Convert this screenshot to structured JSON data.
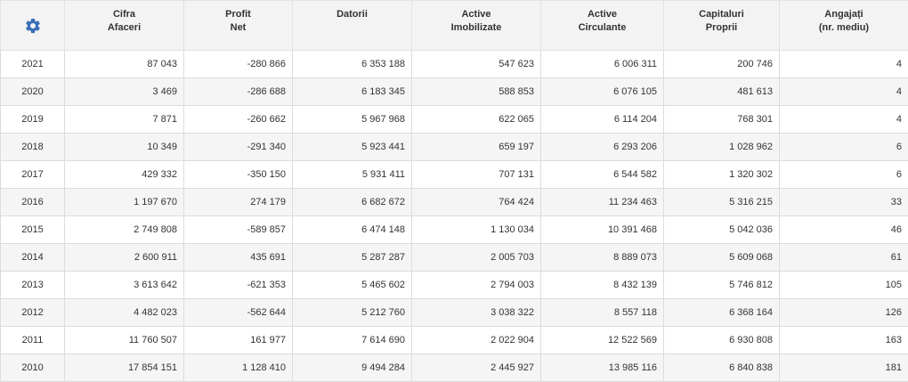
{
  "settings_icon": "gear-icon",
  "accent_color": "#3a6fb8",
  "columns": [
    {
      "line1": "Cifra",
      "line2": "Afaceri"
    },
    {
      "line1": "Profit",
      "line2": "Net"
    },
    {
      "line1": "Datorii",
      "line2": ""
    },
    {
      "line1": "Active",
      "line2": "Imobilizate"
    },
    {
      "line1": "Active",
      "line2": "Circulante"
    },
    {
      "line1": "Capitaluri",
      "line2": "Proprii"
    },
    {
      "line1": "Angajați",
      "line2": "(nr. mediu)"
    }
  ],
  "rows": [
    [
      "2021",
      "87 043",
      "-280 866",
      "6 353 188",
      "547 623",
      "6 006 311",
      "200 746",
      "4"
    ],
    [
      "2020",
      "3 469",
      "-286 688",
      "6 183 345",
      "588 853",
      "6 076 105",
      "481 613",
      "4"
    ],
    [
      "2019",
      "7 871",
      "-260 662",
      "5 967 968",
      "622 065",
      "6 114 204",
      "768 301",
      "4"
    ],
    [
      "2018",
      "10 349",
      "-291 340",
      "5 923 441",
      "659 197",
      "6 293 206",
      "1 028 962",
      "6"
    ],
    [
      "2017",
      "429 332",
      "-350 150",
      "5 931 411",
      "707 131",
      "6 544 582",
      "1 320 302",
      "6"
    ],
    [
      "2016",
      "1 197 670",
      "274 179",
      "6 682 672",
      "764 424",
      "11 234 463",
      "5 316 215",
      "33"
    ],
    [
      "2015",
      "2 749 808",
      "-589 857",
      "6 474 148",
      "1 130 034",
      "10 391 468",
      "5 042 036",
      "46"
    ],
    [
      "2014",
      "2 600 911",
      "435 691",
      "5 287 287",
      "2 005 703",
      "8 889 073",
      "5 609 068",
      "61"
    ],
    [
      "2013",
      "3 613 642",
      "-621 353",
      "5 465 602",
      "2 794 003",
      "8 432 139",
      "5 746 812",
      "105"
    ],
    [
      "2012",
      "4 482 023",
      "-562 644",
      "5 212 760",
      "3 038 322",
      "8 557 118",
      "6 368 164",
      "126"
    ],
    [
      "2011",
      "11 760 507",
      "161 977",
      "7 614 690",
      "2 022 904",
      "12 522 569",
      "6 930 808",
      "163"
    ],
    [
      "2010",
      "17 854 151",
      "1 128 410",
      "9 494 284",
      "2 445 927",
      "13 985 116",
      "6 840 838",
      "181"
    ]
  ]
}
